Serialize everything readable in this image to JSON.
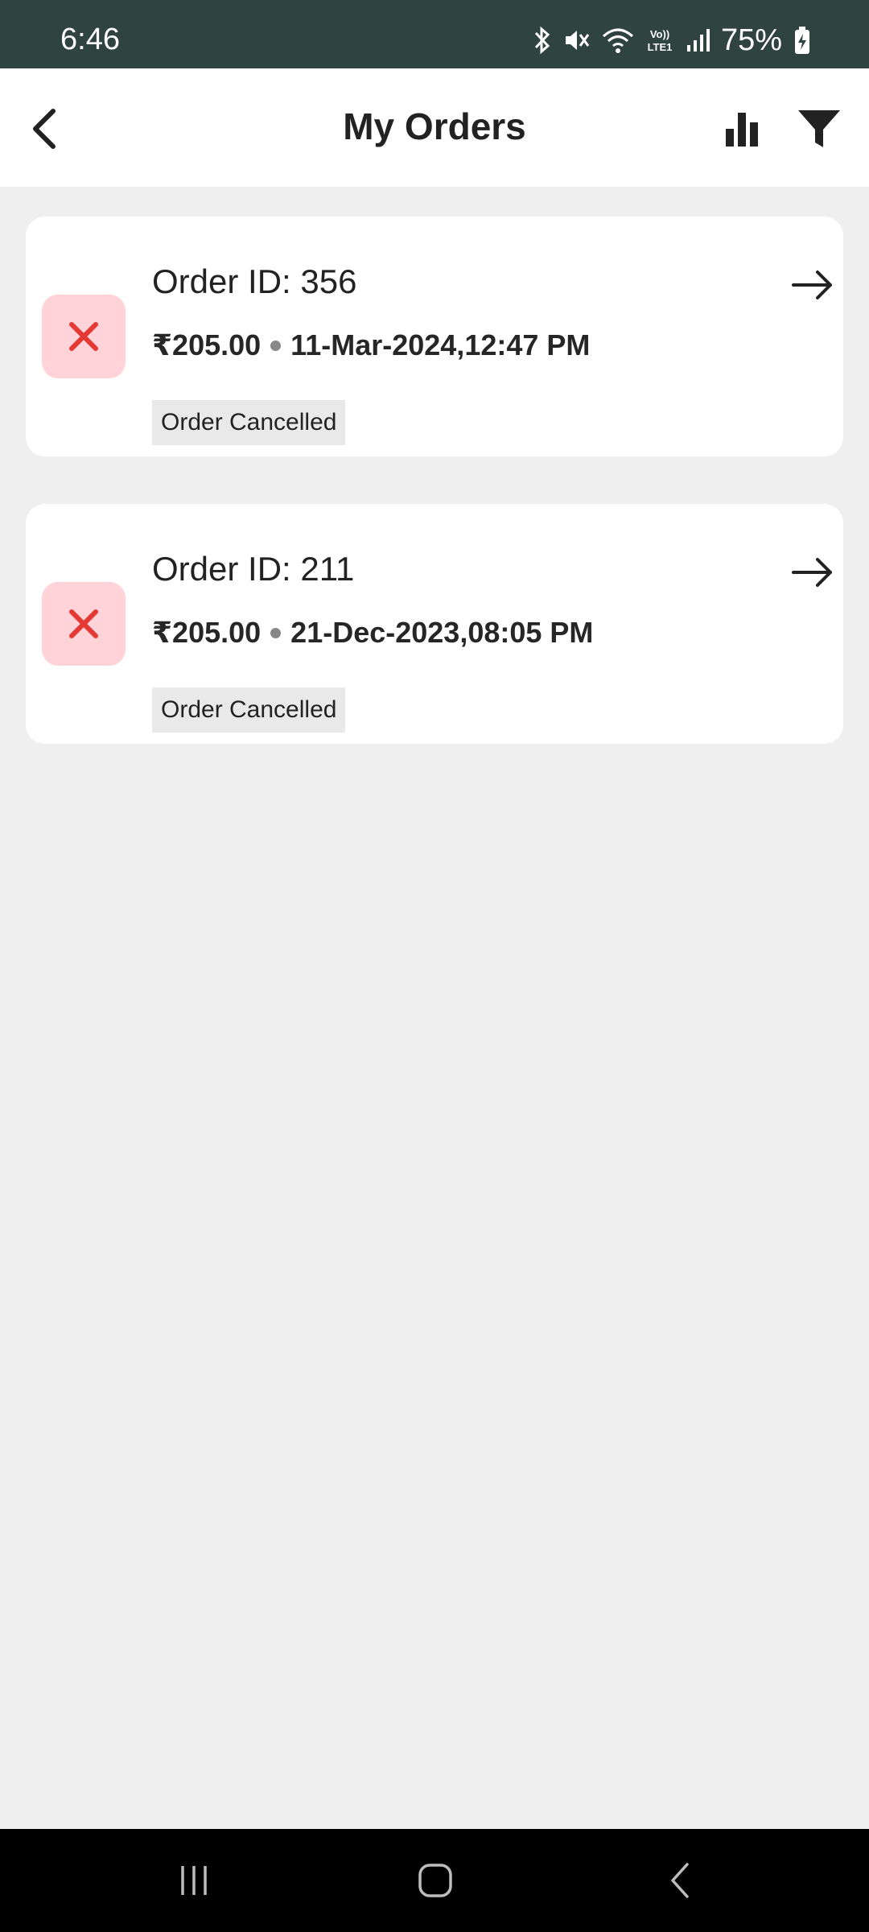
{
  "status_bar": {
    "time": "6:46",
    "battery": "75%",
    "icons": [
      "bluetooth-icon",
      "mute-icon",
      "wifi-icon",
      "volte-icon",
      "signal-icon",
      "battery-icon"
    ]
  },
  "header": {
    "title": "My Orders",
    "back_icon": "chevron-left-icon",
    "chart_icon": "bar-chart-icon",
    "filter_icon": "filter-icon"
  },
  "orders": [
    {
      "id_label": "Order ID: 356",
      "amount": "₹205.00",
      "datetime": "11-Mar-2024,12:47 PM",
      "status": "Order Cancelled"
    },
    {
      "id_label": "Order ID: 211",
      "amount": "₹205.00",
      "datetime": "21-Dec-2023,08:05 PM",
      "status": "Order Cancelled"
    }
  ],
  "colors": {
    "status_bar": "#2f4340",
    "cancel_badge_bg": "#ffd3d8",
    "cancel_icon": "#e53935",
    "page_bg": "#efefef"
  },
  "nav_bar": {
    "icons": [
      "recent-apps-icon",
      "home-icon",
      "back-icon"
    ]
  }
}
